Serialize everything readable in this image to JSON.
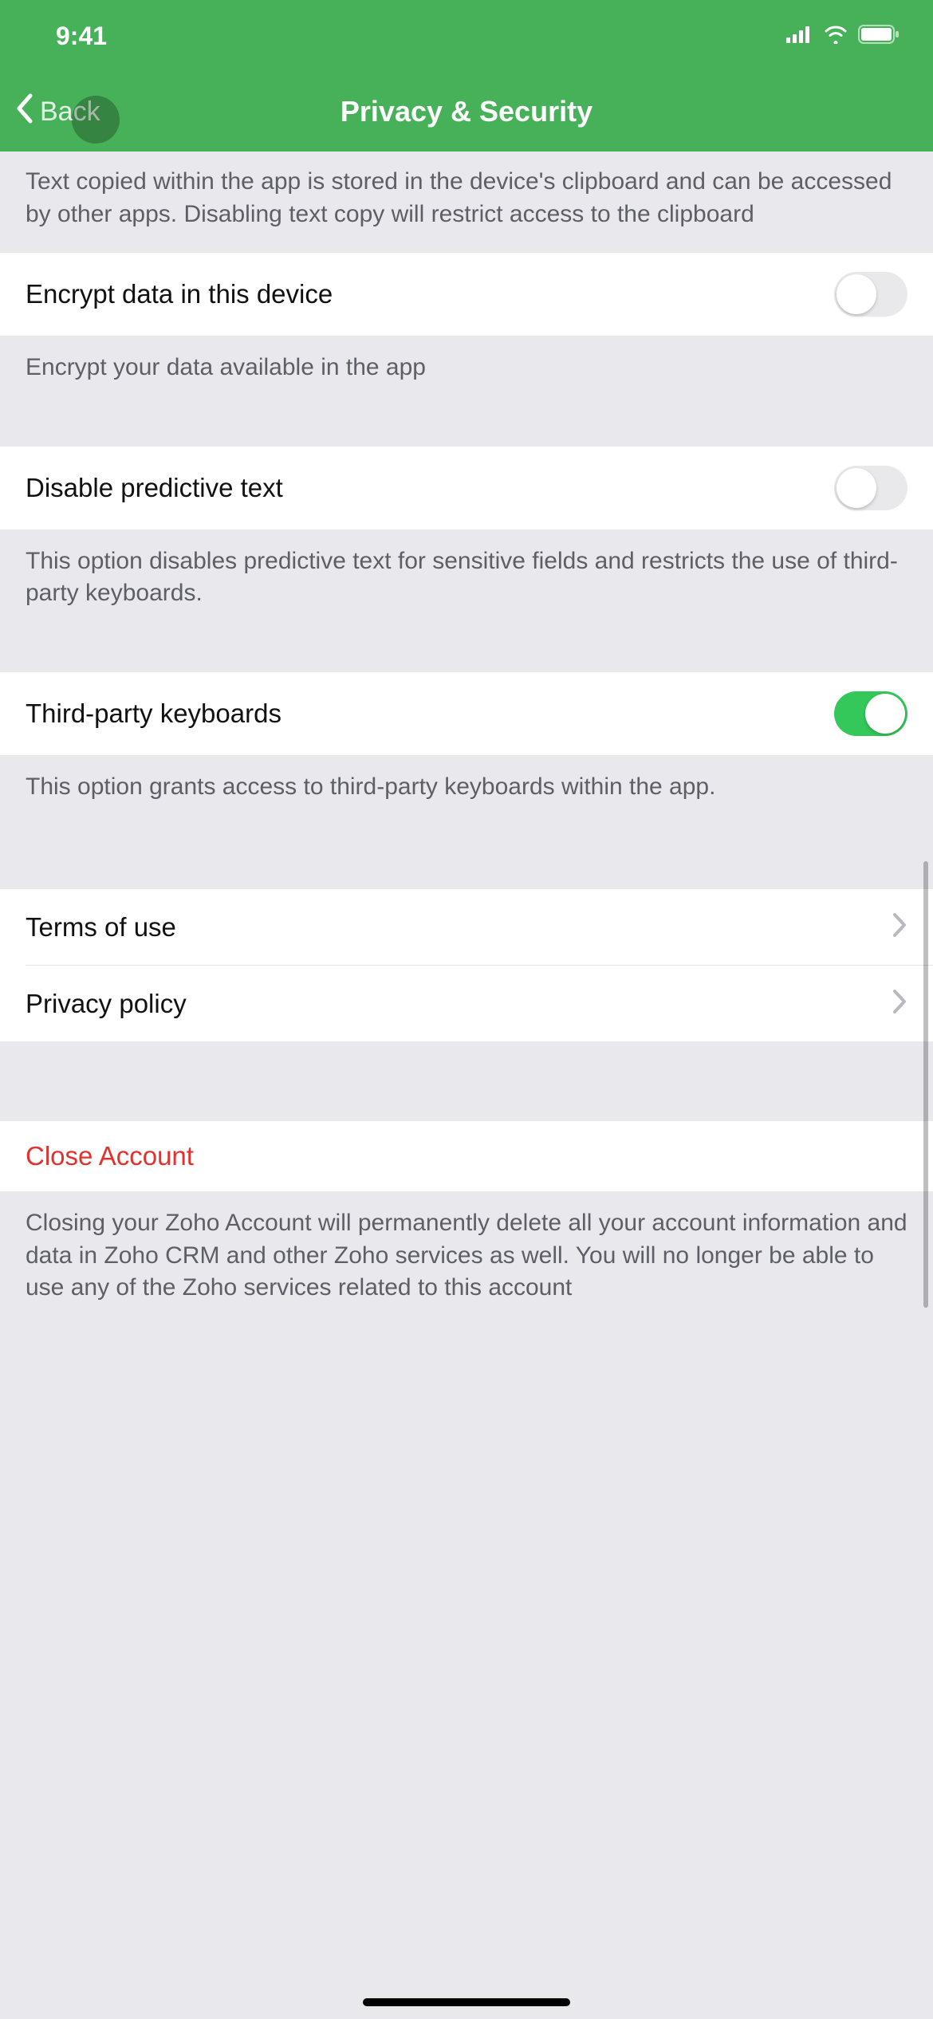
{
  "status": {
    "time": "9:41"
  },
  "nav": {
    "back_label": "Back",
    "title": "Privacy & Security"
  },
  "clipboard": {
    "desc": "Text copied within the app is stored in the device's clipboard and can be accessed by other apps. Disabling text copy will restrict access to the clipboard"
  },
  "encrypt": {
    "label": "Encrypt data in this device",
    "desc": "Encrypt your data available in the app",
    "on": false
  },
  "predictive": {
    "label": "Disable predictive text",
    "desc": "This option disables predictive text for sensitive fields and restricts the use of third-party keyboards.",
    "on": false
  },
  "third_party": {
    "label": "Third-party keyboards",
    "desc": "This option grants access to third-party keyboards within the app.",
    "on": true
  },
  "links": {
    "terms": "Terms of use",
    "privacy": "Privacy policy"
  },
  "close_account": {
    "label": "Close Account",
    "desc": "Closing your Zoho Account will permanently delete all your account information and data in Zoho CRM and other Zoho services as well. You will no longer be able to use any of the Zoho services related to this account"
  }
}
